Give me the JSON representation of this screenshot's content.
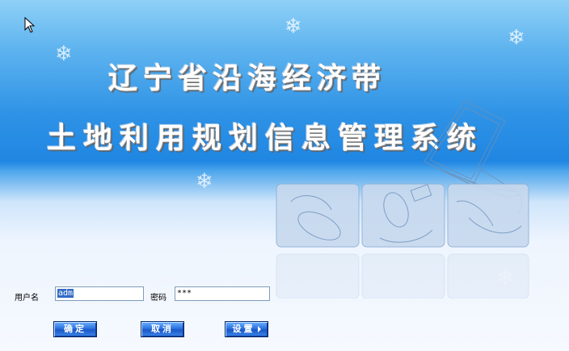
{
  "title": {
    "line1": "辽宁省沿海经济带",
    "line2": "土地利用规划信息管理系统"
  },
  "form": {
    "username_label": "用户名",
    "username_value": "adm",
    "password_label": "密码",
    "password_value": "***"
  },
  "buttons": {
    "ok": "确定",
    "cancel": "取消",
    "settings": "设置"
  },
  "colors": {
    "brand_blue": "#1f86e2",
    "button_blue": "#2b72e0"
  },
  "icons": [
    "cursor-arrow-icon",
    "snowflake-icon",
    "laptop-illustration",
    "mouse-illustration"
  ]
}
